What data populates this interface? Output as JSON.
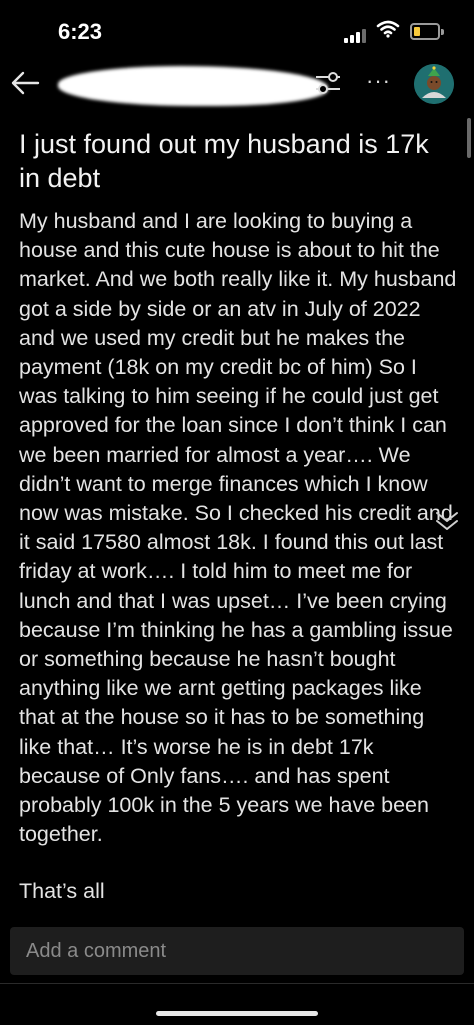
{
  "status_bar": {
    "time": "6:23",
    "battery_color": "#f7c93c"
  },
  "nav": {
    "back_icon": "arrow-left-icon",
    "filter_icon": "sliders-icon",
    "more_label": "···",
    "avatar_icon": "avatar-icon"
  },
  "post": {
    "title": "I just found out my husband is 17k in debt",
    "body": "My husband and I are looking to buying a house and this cute house is about to hit the market. And we both really like it. My husband got a side by side or an atv in July of 2022 and we used my credit but he makes the payment (18k on my credit bc of him) So I was talking to him seeing if he could just get approved for the loan since I don’t think I can we been married for almost a year…. We didn’t want to merge finances which I know now was mistake. So I checked his credit and it said 17580 almost 18k. I found this out last friday at work…. I told him to meet me for lunch and that I was upset… I’ve been crying because I’m thinking he has a gambling issue or something because he hasn’t bought anything like we arnt getting packages like that at the house so it has to be something like that… It’s worse he is in debt 17k because of  Only fans…. and has spent probably 100k in the 5 years we have been together.",
    "ending": "That’s all"
  },
  "comment": {
    "placeholder": "Add a comment"
  }
}
